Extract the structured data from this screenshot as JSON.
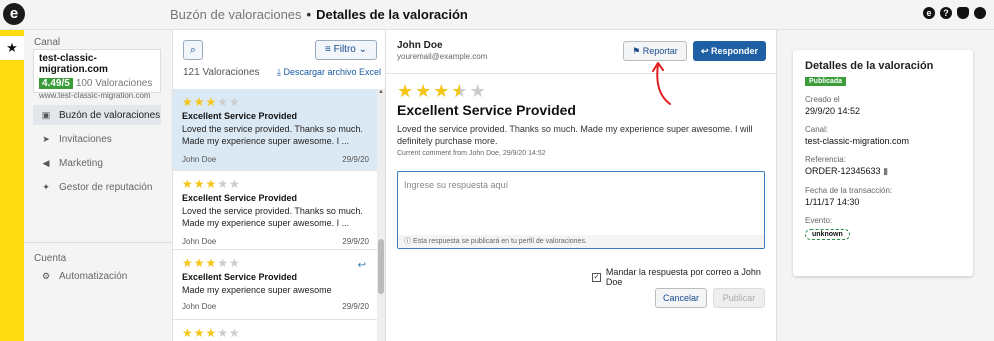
{
  "header": {
    "breadcrumb_parent": "Buzón de valoraciones",
    "breadcrumb_sep": "•",
    "breadcrumb_current": "Detalles de la valoración"
  },
  "sidebar": {
    "canal_label": "Canal",
    "channel_name": "test-classic-migration.com",
    "channel_rating": "4.49/5",
    "channel_reviews": "100 Valoraciones",
    "channel_url": "www.test-classic-migration.com",
    "nav": [
      {
        "label": "Buzón de valoraciones",
        "icon": "inbox-icon"
      },
      {
        "label": "Invitaciones",
        "icon": "send-icon"
      },
      {
        "label": "Marketing",
        "icon": "megaphone-icon"
      },
      {
        "label": "Gestor de reputación",
        "icon": "sparkle-icon"
      }
    ],
    "cuenta_label": "Cuenta",
    "account_nav": [
      {
        "label": "Automatización",
        "icon": "robot-icon"
      }
    ]
  },
  "list": {
    "filter_label": "Filtro",
    "count": "121 Valoraciones",
    "download": "Descargar archivo Excel",
    "items": [
      {
        "stars": 3,
        "title": "Excellent Service Provided",
        "body": "Loved the service provided. Thanks so much. Made my experience super awesome. I ...",
        "author": "John Doe",
        "date": "29/9/20"
      },
      {
        "stars": 3,
        "title": "Excellent Service Provided",
        "body": "Loved the service provided. Thanks so much. Made my experience super awesome. I ...",
        "author": "John Doe",
        "date": "29/9/20"
      },
      {
        "stars": 3,
        "title": "Excellent Service Provided",
        "body": "Made my experience super awesome",
        "author": "John Doe",
        "date": "29/9/20"
      }
    ],
    "partial_item_stars": 3
  },
  "detail": {
    "name": "John Doe",
    "email": "youremail@example.com",
    "report_label": "Reportar",
    "reply_label": "Responder",
    "stars": 3.5,
    "title": "Excellent Service Provided",
    "body": "Loved the service provided. Thanks so much. Made my experience super awesome. I will definitely purchase more.",
    "comment_note": "Current comment from John Doe, 29/9/20 14:52",
    "reply_placeholder": "Ingrese su respuesta aquí",
    "reply_hint": "Esta respuesta se publicará en tu perfil de valoraciones.",
    "email_check_label": "Mandar la respuesta por correo a John Doe",
    "cancel_label": "Cancelar",
    "publish_label": "Publicar"
  },
  "card": {
    "title": "Detalles de la valoración",
    "status": "Publicada",
    "created_label": "Creado el",
    "created_value": "29/9/20 14:52",
    "channel_label": "Canal:",
    "channel_value": "test-classic-migration.com",
    "ref_label": "Referencia:",
    "ref_value": "ORDER-12345633",
    "tx_label": "Fecha de la transacción:",
    "tx_value": "1/11/17 14:30",
    "event_label": "Evento:",
    "event_value": "unknown"
  },
  "colors": {
    "brand_yellow": "#ffdc0f",
    "primary_blue": "#1f5fa4",
    "success_green": "#3a9d3a",
    "annotation_red": "#e02020"
  }
}
